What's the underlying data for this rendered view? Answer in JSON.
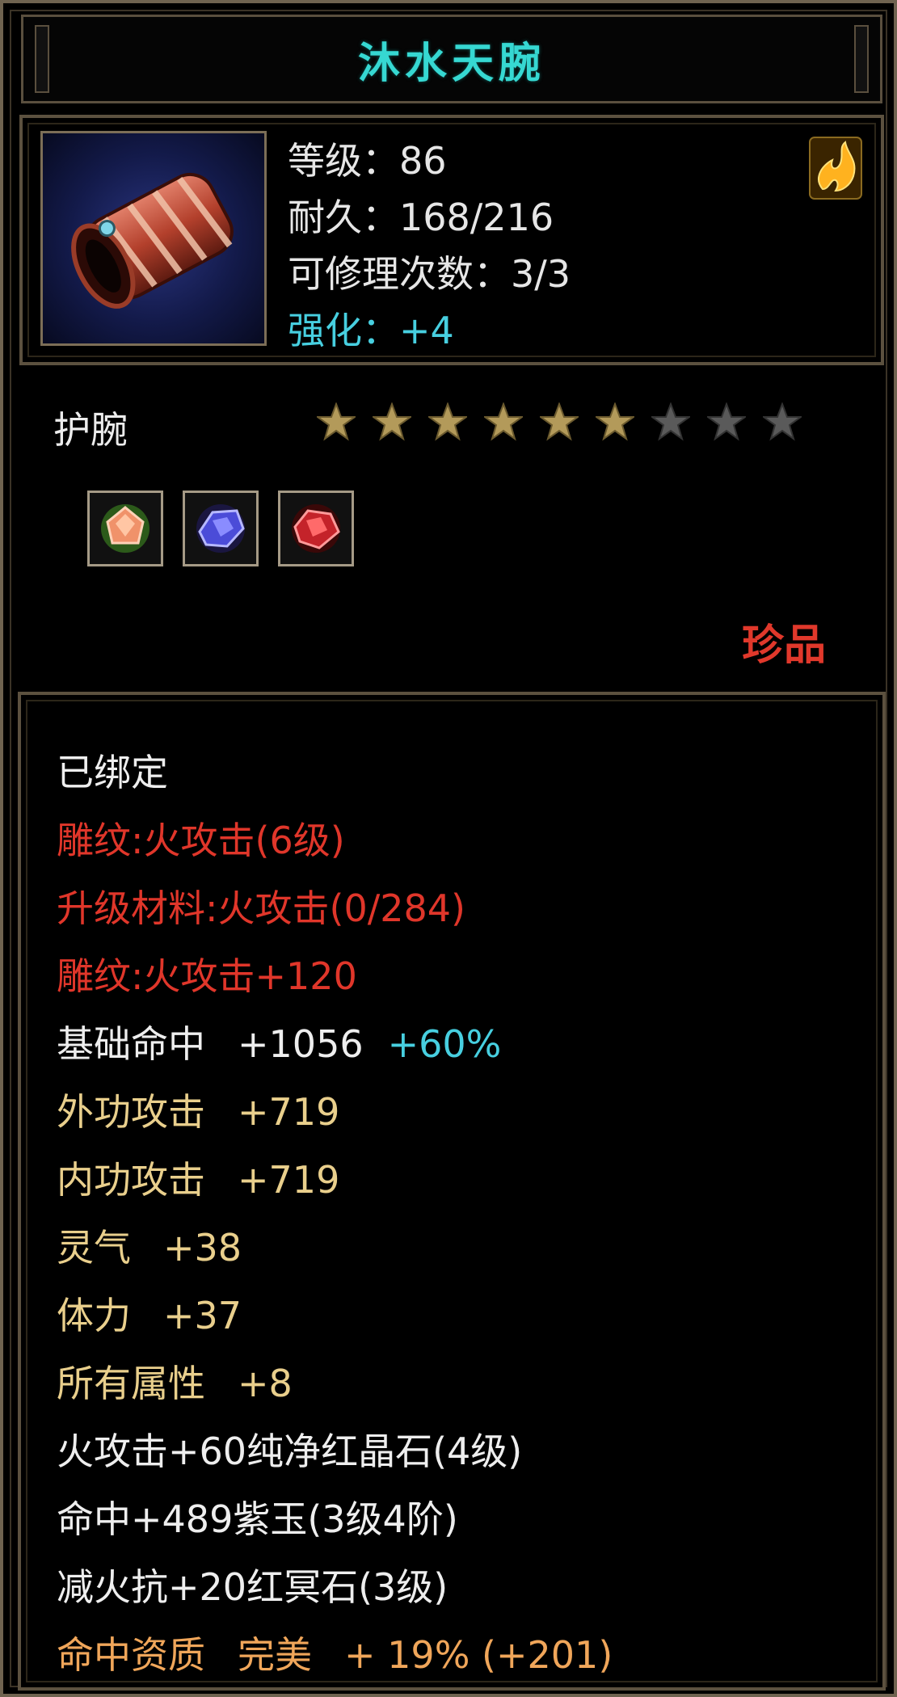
{
  "title": "沐水天腕",
  "header": {
    "level": "等级：86",
    "durability": "耐久：168/216",
    "repair_count": "可修理次数：3/3",
    "enhance": "强化：+4"
  },
  "item_type": "护腕",
  "stars": {
    "filled": 6,
    "total": 9
  },
  "gems": [
    "gem-orange-icon",
    "gem-blue-icon",
    "gem-red-icon"
  ],
  "rarity": "珍品",
  "properties": {
    "bound": "已绑定",
    "engrave_level": "雕纹:火攻击(6级)",
    "upgrade_material": "升级材料:火攻击(0/284)",
    "engrave_bonus": "雕纹:火攻击+120",
    "hit": {
      "label": "基础命中",
      "value": "+1056",
      "bonus": "+60%"
    },
    "outer_attack": {
      "label": "外功攻击",
      "value": "+719"
    },
    "inner_attack": {
      "label": "内功攻击",
      "value": "+719"
    },
    "spirit": {
      "label": "灵气",
      "value": "+38"
    },
    "stamina": {
      "label": "体力",
      "value": "+37"
    },
    "all_attr": {
      "label": "所有属性",
      "value": "+8"
    },
    "gem_line_1": "火攻击+60纯净红晶石(4级)",
    "gem_line_2": "命中+489紫玉(3级4阶)",
    "gem_line_3": "减火抗+20红冥石(3级)",
    "aptitude": {
      "label": "命中资质",
      "grade": "完美",
      "value": "+ 19% (+201)"
    }
  },
  "colors": {
    "title": "#36d8d2",
    "red": "#e0362a",
    "gold": "#e9cf8c",
    "cyan": "#47cfe0",
    "orange": "#f0a65a",
    "star_filled": "#b39a5a",
    "star_empty": "#5a5a5a"
  }
}
